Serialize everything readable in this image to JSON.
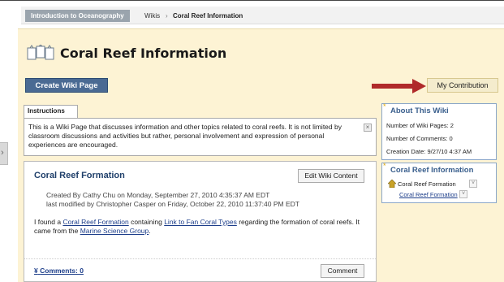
{
  "breadcrumb": {
    "course": "Introduction to Oceanography",
    "wikis": "Wikis",
    "current": "Coral Reef Information"
  },
  "header": {
    "title": "Coral Reef Information",
    "create_label": "Create Wiki Page",
    "contribution_label": "My Contribution"
  },
  "instructions": {
    "tab_label": "Instructions",
    "text": "This is a Wiki Page that discusses information and other topics related to coral reefs. It is not limited by classroom discussions and activities but rather, personal involvement and expression of personal experiences are encouraged."
  },
  "entry": {
    "title": "Coral Reef Formation",
    "edit_label": "Edit Wiki Content",
    "created": "Created By Cathy Chu on Monday, September 27, 2010 4:35:37 AM EDT",
    "modified": "last modified by Christopher Casper on Friday, October 22, 2010 11:37:40 PM EDT",
    "body_pre": "I found a ",
    "link1": "Coral Reef Formation",
    "body_mid1": "  containing ",
    "link2": "Link to Fan Coral Types",
    "body_mid2": " regarding the formation of coral reefs. It came from the ",
    "link3": "Marine Science Group",
    "body_post": ".",
    "comments_label": "Comments: 0",
    "comment_button": "Comment"
  },
  "about": {
    "heading": "About This Wiki",
    "pages": "Number of Wiki Pages: 2",
    "comments": "Number of Comments: 0",
    "created": "Creation Date: 9/27/10 4:37 AM"
  },
  "wiki_info": {
    "heading": "Coral Reef Information",
    "items": [
      "Coral Reef Formation",
      "Coral Reef Formation"
    ]
  },
  "colors": {
    "accent": "#4a6a93",
    "panel": "#fdf3d4",
    "arrow": "#b02a2a"
  },
  "icons": [
    "wiki-pages-icon",
    "close-icon",
    "home-icon",
    "chevron-down-icon",
    "star-icon",
    "right-arrow-icon"
  ]
}
